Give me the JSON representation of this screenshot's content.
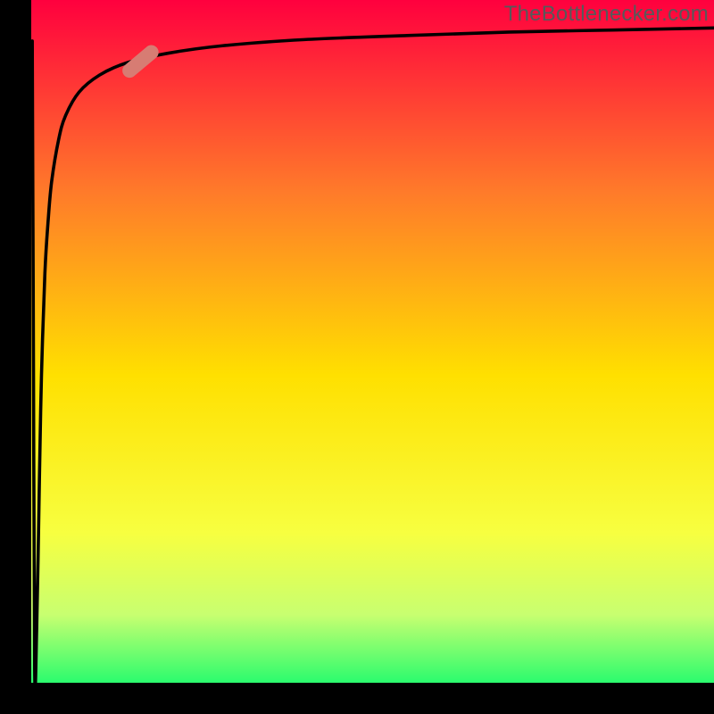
{
  "watermark": "TheBottlenecker.com",
  "colors": {
    "background_gradient": {
      "top": "#ff003e",
      "upper_mid": "#ff7a2a",
      "mid": "#ffe000",
      "lower_mid": "#f7ff40",
      "lower": "#c8ff70",
      "bottom": "#2bfc6e"
    },
    "curve_stroke": "#000000",
    "marker_fill": "#d77c73",
    "axis_fill": "#000000"
  },
  "chart_data": {
    "type": "line",
    "title": "",
    "xlabel": "",
    "ylabel": "",
    "xlim": [
      0,
      100
    ],
    "ylim": [
      0,
      100
    ],
    "x": [
      0.5,
      0.8,
      1.0,
      1.2,
      1.5,
      2.0,
      2.5,
      3.0,
      4.0,
      5.0,
      7.0,
      10.0,
      14.0,
      20.0,
      28.0,
      40.0,
      55.0,
      70.0,
      85.0,
      100.0
    ],
    "y": [
      2.0,
      8.0,
      18.0,
      30.0,
      45.0,
      60.0,
      68.0,
      73.5,
      79.5,
      83.0,
      86.5,
      89.0,
      90.8,
      92.2,
      93.3,
      94.2,
      94.8,
      95.3,
      95.6,
      95.9
    ],
    "marker": {
      "x": 16.0,
      "y": 91.0,
      "angle_deg": -40
    }
  }
}
